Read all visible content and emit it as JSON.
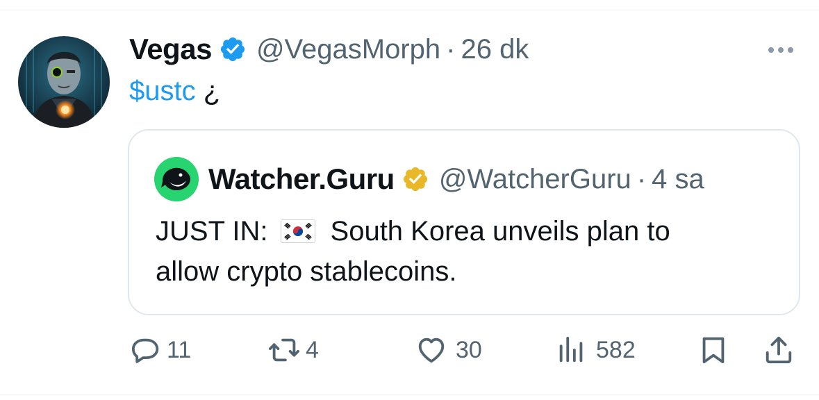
{
  "tweet": {
    "author": {
      "display_name": "Vegas",
      "handle": "@VegasMorph",
      "verified": true,
      "avatar_icon": "avatar-portrait"
    },
    "separator": "·",
    "time": "26 dk",
    "cashtag": "$ustc",
    "text_rest": " ¿",
    "more_icon": "more-horizontal-icon"
  },
  "quote": {
    "author": {
      "display_name": "Watcher.Guru",
      "handle": "@WatcherGuru",
      "verified": true,
      "verified_type": "gold",
      "avatar_icon": "whale-logo"
    },
    "separator": "·",
    "time": "4 sa",
    "text_line1_before": "JUST IN:",
    "text_line1_after": "South Korea unveils plan to",
    "text_line2": "allow crypto stablecoins.",
    "flag_icon": "south-korea-flag"
  },
  "actions": {
    "reply_count": "11",
    "retweet_count": "4",
    "like_count": "30",
    "views_count": "582"
  },
  "colors": {
    "accent": "#1d9bf0",
    "secondary_text": "#536471",
    "gold_badge": "#e8b829",
    "watcher_green": "#28d46f"
  }
}
